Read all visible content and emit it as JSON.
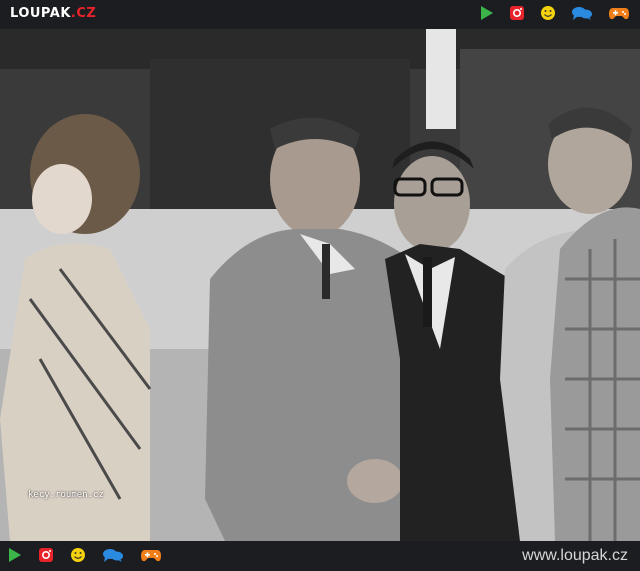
{
  "header": {
    "logo_main": "LOUPAK",
    "logo_suffix": ".CZ",
    "icons": [
      "play-icon",
      "instagram-icon",
      "smiley-icon",
      "chat-icon",
      "gamepad-icon"
    ]
  },
  "photo": {
    "watermark": "kecy.roumen.cz"
  },
  "footer": {
    "url": "www.loupak.cz",
    "icons": [
      "play-icon",
      "instagram-icon",
      "smiley-icon",
      "chat-icon",
      "gamepad-icon"
    ]
  },
  "colors": {
    "bar_bg": "#1c1d20",
    "play": "#3bb54a",
    "instagram": "#e8232a",
    "smiley": "#f5d20d",
    "chat": "#2a8ae0",
    "gamepad": "#f07f1a"
  }
}
